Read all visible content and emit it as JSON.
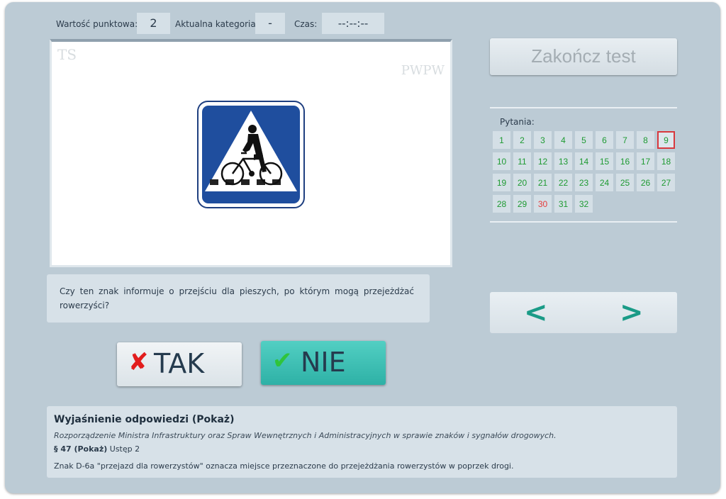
{
  "header": {
    "points_label": "Wartość punktowa:",
    "points_value": "2",
    "category_label": "Aktualna kategoria:",
    "category_value": "-",
    "time_label": "Czas:",
    "time_value": "--:--:--"
  },
  "media": {
    "watermark_left": "TS",
    "watermark_right": "PWPW",
    "sign_code": "D-6a"
  },
  "end_button_label": "Zakończ test",
  "questions": {
    "title": "Pytania:",
    "current": "9",
    "items": [
      {
        "n": "1",
        "state": "answered"
      },
      {
        "n": "2",
        "state": "answered"
      },
      {
        "n": "3",
        "state": "answered"
      },
      {
        "n": "4",
        "state": "answered"
      },
      {
        "n": "5",
        "state": "answered"
      },
      {
        "n": "6",
        "state": "answered"
      },
      {
        "n": "7",
        "state": "answered"
      },
      {
        "n": "8",
        "state": "answered"
      },
      {
        "n": "9",
        "state": "current"
      },
      {
        "n": "10",
        "state": "answered"
      },
      {
        "n": "11",
        "state": "answered"
      },
      {
        "n": "12",
        "state": "answered"
      },
      {
        "n": "13",
        "state": "answered"
      },
      {
        "n": "14",
        "state": "answered"
      },
      {
        "n": "15",
        "state": "answered"
      },
      {
        "n": "16",
        "state": "answered"
      },
      {
        "n": "17",
        "state": "answered"
      },
      {
        "n": "18",
        "state": "answered"
      },
      {
        "n": "19",
        "state": "answered"
      },
      {
        "n": "20",
        "state": "answered"
      },
      {
        "n": "21",
        "state": "answered"
      },
      {
        "n": "22",
        "state": "answered"
      },
      {
        "n": "23",
        "state": "answered"
      },
      {
        "n": "24",
        "state": "answered"
      },
      {
        "n": "25",
        "state": "answered"
      },
      {
        "n": "26",
        "state": "answered"
      },
      {
        "n": "27",
        "state": "answered"
      },
      {
        "n": "28",
        "state": "answered"
      },
      {
        "n": "29",
        "state": "answered"
      },
      {
        "n": "30",
        "state": "wrong"
      },
      {
        "n": "31",
        "state": "answered"
      },
      {
        "n": "32",
        "state": "answered"
      }
    ]
  },
  "question_text": "Czy ten znak informuje o przejściu dla pieszych, po którym mogą przejeżdżać rowerzyści?",
  "nav": {
    "prev_icon": "chevron-left-icon",
    "next_icon": "chevron-right-icon"
  },
  "answers": {
    "yes_label": "TAK",
    "yes_icon": "x-mark-icon",
    "no_label": "NIE",
    "no_icon": "check-mark-icon",
    "selected": "NIE"
  },
  "explanation": {
    "heading": "Wyjaśnienie odpowiedzi (Pokaż)",
    "law": "Rozporządzenie Ministra Infrastruktury oraz Spraw Wewnętrznych i Administracyjnych w sprawie znaków i sygnałów drogowych.",
    "paragraph_ref": "§ 47 (Pokaż)",
    "paragraph_rest": " Ustęp 2",
    "description": "Znak D-6a \"przejazd dla rowerzystów\" oznacza miejsce przeznaczone do przejeżdżania rowerzystów w poprzek drogi."
  },
  "colors": {
    "panel_bg": "#bccbd5",
    "accent_teal": "#1a9b87",
    "answered_green": "#1e9a32",
    "wrong_red": "#e53b3b",
    "selected_answer_bg": "#3cc1b5",
    "sign_blue": "#1f4e9e"
  }
}
